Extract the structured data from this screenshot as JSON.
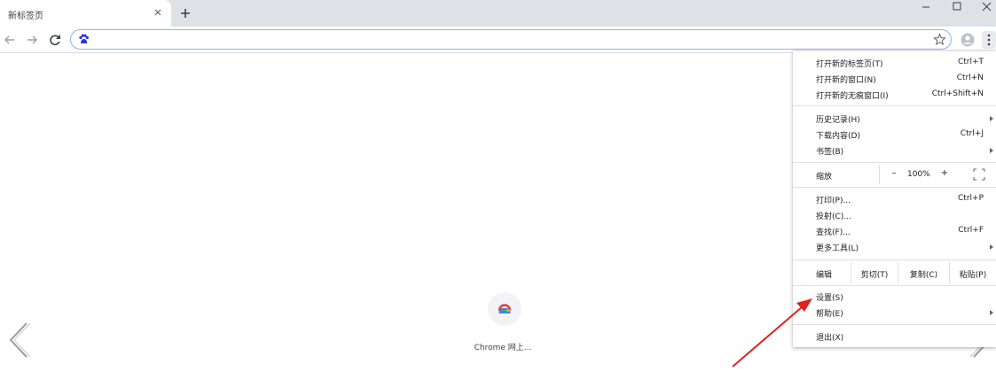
{
  "tab": {
    "title": "新标签页"
  },
  "shortcut": {
    "label": "Chrome 网上..."
  },
  "menu": {
    "new_tab": {
      "label": "打开新的标签页(T)",
      "shortcut": "Ctrl+T"
    },
    "new_window": {
      "label": "打开新的窗口(N)",
      "shortcut": "Ctrl+N"
    },
    "incognito": {
      "label": "打开新的无痕窗口(I)",
      "shortcut": "Ctrl+Shift+N"
    },
    "history": {
      "label": "历史记录(H)"
    },
    "downloads": {
      "label": "下载内容(D)",
      "shortcut": "Ctrl+J"
    },
    "bookmarks": {
      "label": "书签(B)"
    },
    "zoom": {
      "label": "缩放",
      "minus": "–",
      "value": "100%",
      "plus": "+"
    },
    "print": {
      "label": "打印(P)...",
      "shortcut": "Ctrl+P"
    },
    "cast": {
      "label": "投射(C)..."
    },
    "find": {
      "label": "查找(F)...",
      "shortcut": "Ctrl+F"
    },
    "more_tools": {
      "label": "更多工具(L)"
    },
    "edit": {
      "label": "编辑",
      "cut": "剪切(T)",
      "copy": "复制(C)",
      "paste": "粘贴(P)"
    },
    "settings": {
      "label": "设置(S)"
    },
    "help": {
      "label": "帮助(E)"
    },
    "exit": {
      "label": "退出(X)"
    }
  },
  "colors": {
    "tabstrip": "#dee1e6",
    "omnibox_focus": "#8ab4f8",
    "annotation_arrow": "#e02020",
    "baidu_blue": "#2932e1"
  },
  "icons": [
    "close-icon",
    "plus-icon",
    "back-arrow-icon",
    "forward-arrow-icon",
    "reload-icon",
    "baidu-paw-icon",
    "star-icon",
    "profile-icon",
    "kebab-menu-icon",
    "fullscreen-icon",
    "chevron-left-icon",
    "chevron-right-icon",
    "chrome-web-store-icon"
  ]
}
